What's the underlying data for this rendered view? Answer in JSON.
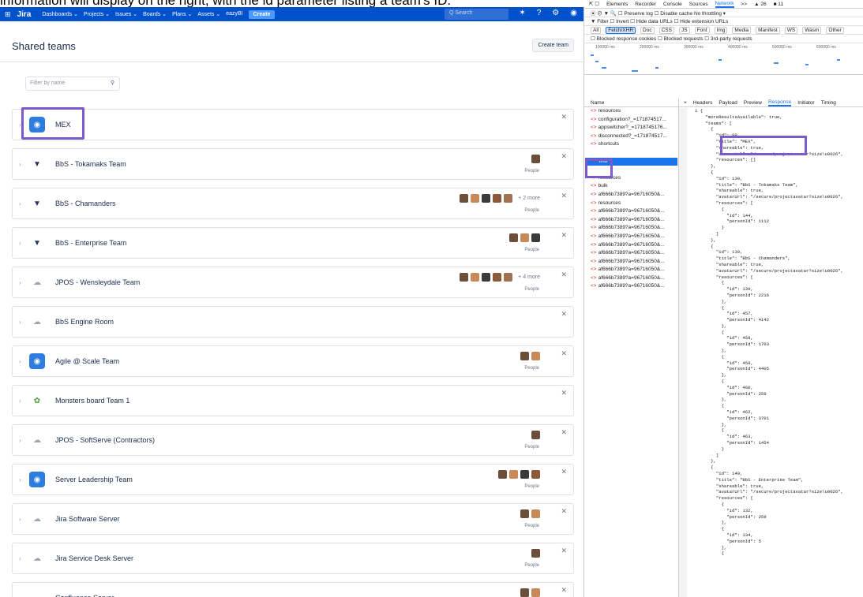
{
  "caption": "information will display on the right, with the id parameter listing a team's ID.",
  "topnav": {
    "logo": "Jira",
    "items": [
      "Dashboards ⌄",
      "Projects ⌄",
      "Issues ⌄",
      "Boards ⌄",
      "Plans ⌄",
      "Assets ⌄",
      "eazyBI"
    ],
    "create": "Create",
    "search_placeholder": "Q Search"
  },
  "page": {
    "title": "Shared teams",
    "create_team": "Create team",
    "filter_placeholder": "Filter by name"
  },
  "teams": [
    {
      "name": "MEX",
      "avatar": "mex",
      "members": 0,
      "people": ""
    },
    {
      "name": "BbS - Tokamaks Team",
      "avatar": "bin",
      "members": 1,
      "people": "People"
    },
    {
      "name": "BbS - Chamanders",
      "avatar": "bin",
      "members": 5,
      "more": "+ 2 more",
      "people": "People"
    },
    {
      "name": "BbS - Enterprise Team",
      "avatar": "bin",
      "members": 3,
      "people": "People"
    },
    {
      "name": "JPOS - Wensleydale Team",
      "avatar": "cloud",
      "members": 5,
      "more": "+ 4 more",
      "people": "People"
    },
    {
      "name": "BbS Engine Room",
      "avatar": "cloud",
      "members": 0,
      "people": ""
    },
    {
      "name": "Agile @ Scale Team",
      "avatar": "mex",
      "members": 2,
      "people": "People"
    },
    {
      "name": "Monsters board Team 1",
      "avatar": "monster",
      "members": 0,
      "people": ""
    },
    {
      "name": "JPOS - SoftServe (Contractors)",
      "avatar": "cloud",
      "members": 1,
      "people": "People"
    },
    {
      "name": "Server Leadership Team",
      "avatar": "mex",
      "members": 4,
      "people": "People"
    },
    {
      "name": "Jira Software Server",
      "avatar": "cloud",
      "members": 2,
      "people": "People"
    },
    {
      "name": "Jira Service Desk Server",
      "avatar": "cloud",
      "members": 1,
      "people": "People"
    },
    {
      "name": "Confluence Server",
      "avatar": "cloud",
      "members": 2,
      "people": ""
    }
  ],
  "devtools": {
    "tabs": [
      "Elements",
      "Recorder",
      "Console",
      "Sources",
      "Network",
      ">>",
      "▲ 26",
      "■ 11"
    ],
    "active_tab": "Network",
    "toolbar": "⦿ ⊘ ▼ 🔍 ☐ Preserve log ☐ Disable cache No throttling ▾",
    "filter_row": "▼ Filter      ☐ Invert  ☐ Hide data URLs  ☐ Hide extension URLs",
    "chips": [
      "All",
      "Fetch/XHR",
      "Doc",
      "CSS",
      "JS",
      "Font",
      "Img",
      "Media",
      "Manifest",
      "WS",
      "Wasm",
      "Other"
    ],
    "blocked_row": "☐ Blocked response cookies ☐ Blocked requests ☐ 3rd-party requests",
    "ticks": [
      "100000 ms",
      "200000 ms",
      "300000 ms",
      "400000 ms",
      "500000 ms",
      "600000 ms"
    ],
    "name_header": "Name",
    "requests": [
      "resources",
      "configuration?_=171874517...",
      "appswitcher?_=1718745176...",
      "disconnected?_=171874517...",
      "shortcuts",
      "",
      "find",
      "",
      "resources",
      "bulk",
      "af666b7389?a=96716050&...",
      "resources",
      "af666b7389?a=96716050&...",
      "af666b7389?a=96716050&...",
      "af666b7389?a=96716050&...",
      "af666b7389?a=96716050&...",
      "af666b7389?a=96716050&...",
      "af666b7389?a=96716050&...",
      "af666b7389?a=96716050&...",
      "af666b7389?a=96716050&...",
      "af666b7389?a=96716050&...",
      "af666b7389?a=96716050&..."
    ],
    "detail_tabs": [
      "×",
      "Headers",
      "Payload",
      "Preview",
      "Response",
      "Initiator",
      "Timing"
    ],
    "active_detail": "Response"
  }
}
